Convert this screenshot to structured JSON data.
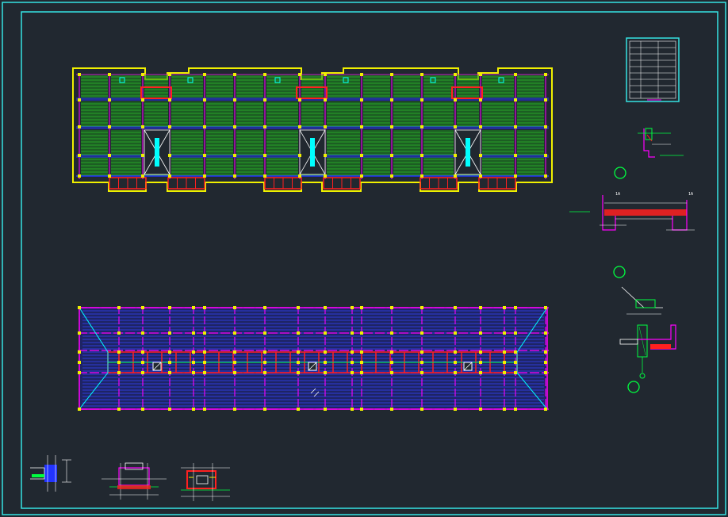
{
  "drawing": {
    "background": "#212830",
    "frame_color": "#35e3e3",
    "palette": {
      "outline": "#f0f000",
      "slab": "#1a8a1a",
      "beam": "#ff2020",
      "axis": "#ff00ff",
      "grid_blue": "#2233ff",
      "cyan": "#00ffff",
      "white": "#ffffff",
      "green_bright": "#00ff40"
    },
    "labels": {
      "tag_a": "1A",
      "tag_b": "1A"
    },
    "detail_markers": [
      {
        "id": "marker-1",
        "symbol": "○"
      },
      {
        "id": "marker-2",
        "symbol": "○"
      },
      {
        "id": "marker-3",
        "symbol": "○"
      }
    ],
    "plans": [
      {
        "id": "upper-floor-slab-plan",
        "kind": "floor-slab-plan"
      },
      {
        "id": "lower-roof-plan",
        "kind": "roof-framing-plan"
      }
    ],
    "legend_table": {
      "rows": 9,
      "columns": 3
    }
  }
}
